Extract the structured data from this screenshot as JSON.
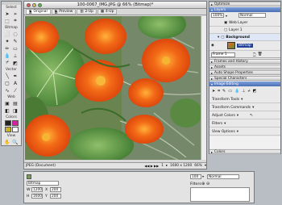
{
  "toolbox": {
    "select_label": "Select",
    "bitmap_label": "Bitmap",
    "vector_label": "Vector",
    "web_label": "Web",
    "colors_label": "Colors",
    "view_label": "View"
  },
  "document": {
    "title": "100-0067_IMG.JPG @ 66% (Bitmap)*",
    "tabs": [
      "Original",
      "Preview",
      "2-Up",
      "4-Up"
    ],
    "status_left": "JPEG (Document)",
    "status_page": "1",
    "status_size": "1600 x 1200",
    "status_zoom": "66%"
  },
  "property_inspector": {
    "name_value": "Bitmap",
    "w_label": "W",
    "w_value": "1200",
    "h_label": "H",
    "h_value": "1600",
    "x_label": "X",
    "x_value": "200",
    "y_label": "Y",
    "y_value": "200",
    "opacity_value": "100",
    "blend_value": "Normal",
    "filters_label": "Filters"
  },
  "panels": {
    "optimize_label": "Optimize",
    "layers_label": "Layers",
    "opacity_value": "100%",
    "blend_value": "Normal",
    "layers": [
      "Web Layer",
      "Layer 1",
      "Background",
      "Bitmap"
    ],
    "frame_value": "Frame 1",
    "frames_history_label": "Frames and History",
    "assets_label": "Assets",
    "auto_shape_label": "Auto Shape Properties",
    "special_chars_label": "Special Characters",
    "image_editing_label": "Image Editing",
    "image_editing_items": [
      "Transform Tools",
      "Transform Commands",
      "Adjust Colors",
      "Filters",
      "View Options"
    ],
    "colors_label": "Colors"
  },
  "colors": {
    "window_chrome": "#e7e7e7",
    "panel_header": "#4b6fb8",
    "nasturtium_orange": "#ef5a12",
    "leaf_green": "#4f8a3c"
  }
}
